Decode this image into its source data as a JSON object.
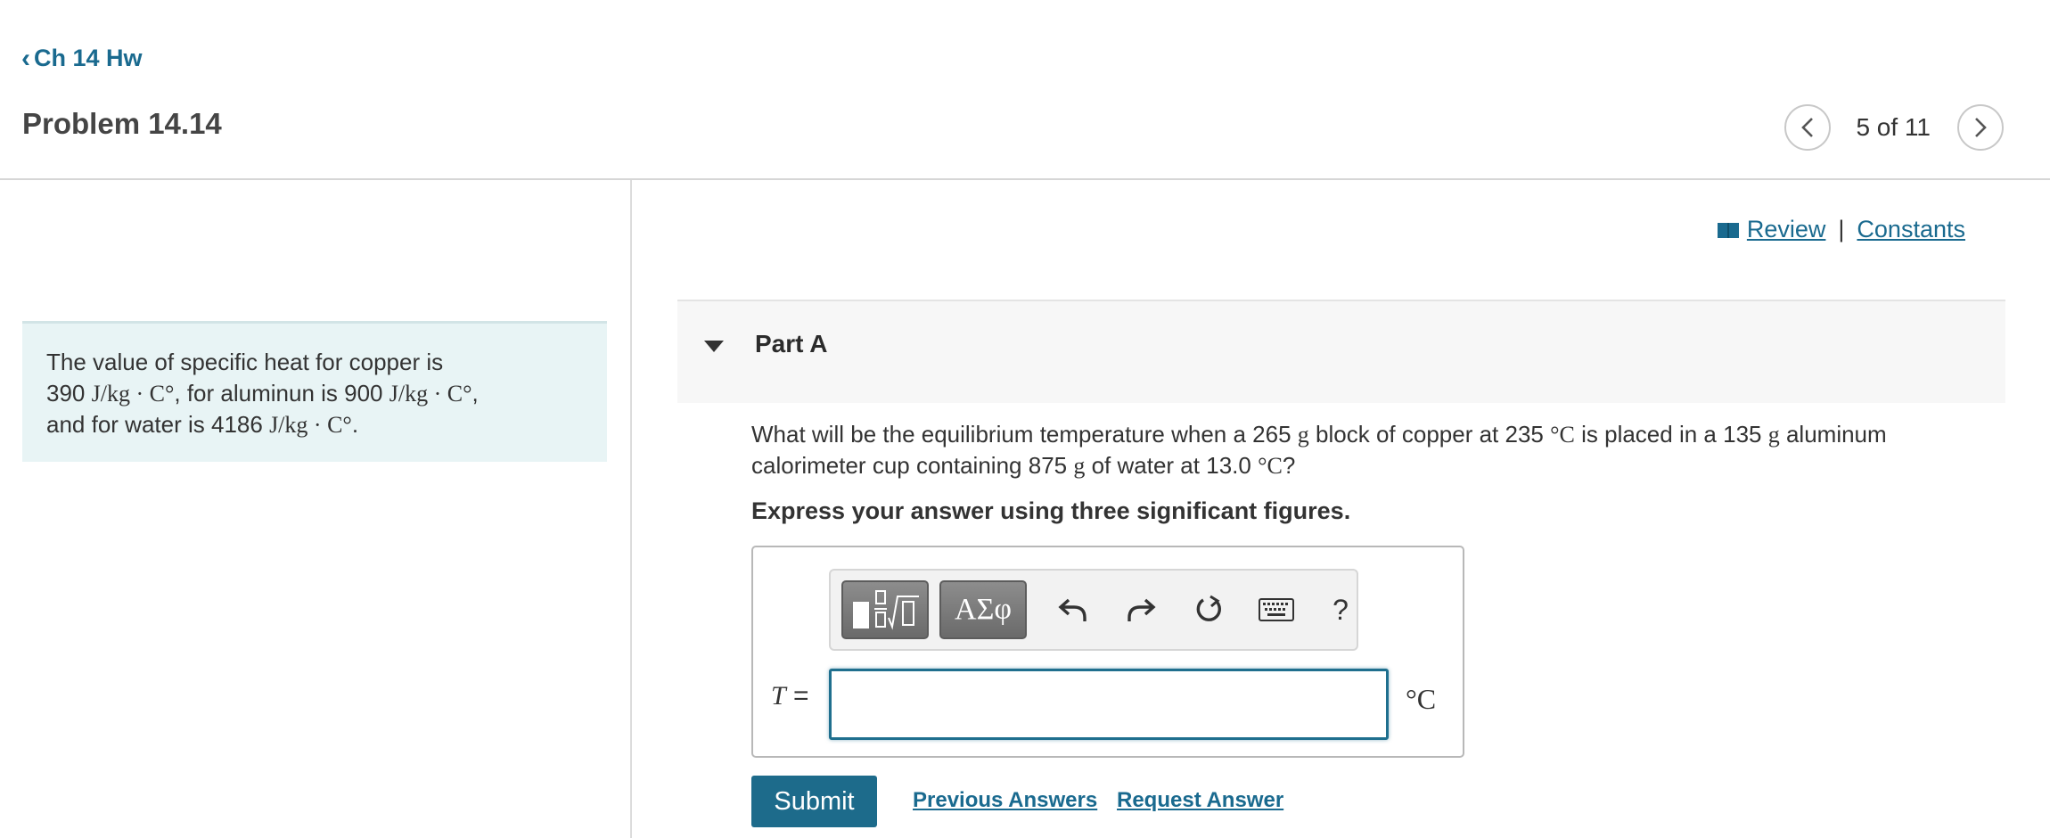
{
  "header": {
    "back_label": "Ch 14 Hw",
    "problem_title": "Problem 14.14",
    "pager": {
      "position": "5 of 11",
      "prev_icon": "chevron-left-icon",
      "next_icon": "chevron-right-icon"
    }
  },
  "info_panel": {
    "line1": "The value of specific heat for copper is",
    "line2_a": "390",
    "unit": "J/kg · C°",
    "line2_b": ", for aluminun is",
    "line2_c": "900",
    "line2_d": ",",
    "line3_a": "and for water is",
    "line3_b": "4186",
    "line3_c": "."
  },
  "top_links": {
    "review": "Review",
    "separator": "|",
    "constants": "Constants",
    "review_icon": "book-icon"
  },
  "part": {
    "label": "Part A",
    "collapse_icon": "caret-down-icon"
  },
  "question": {
    "t1": "What will be the equilibrium temperature when a",
    "mass_copper": "265",
    "g": "g",
    "t2": "block of copper at",
    "temp_copper": "235",
    "deg_c": "°C",
    "t3": "is placed in a",
    "mass_al": "135",
    "t4": "aluminum calorimeter cup containing",
    "mass_water": "875",
    "t5": "of water at",
    "temp_water": "13.0",
    "t6": "?"
  },
  "instruction": "Express your answer using three significant figures.",
  "answer": {
    "toolbar": {
      "template_icon": "fraction-root-template-icon",
      "greek_label": "ΑΣφ",
      "undo_icon": "undo-icon",
      "redo_icon": "redo-icon",
      "reset_icon": "reset-icon",
      "keyboard_icon": "keyboard-icon",
      "help_label": "?"
    },
    "variable": "T",
    "equals": "=",
    "value": "",
    "unit": "°C"
  },
  "actions": {
    "submit": "Submit",
    "previous_answers": "Previous Answers",
    "request_answer": "Request Answer"
  },
  "colors": {
    "accent": "#1d6b8b",
    "link": "#1a6a8f",
    "info_bg": "#e8f4f5",
    "toolbar_btn": "#777777"
  }
}
